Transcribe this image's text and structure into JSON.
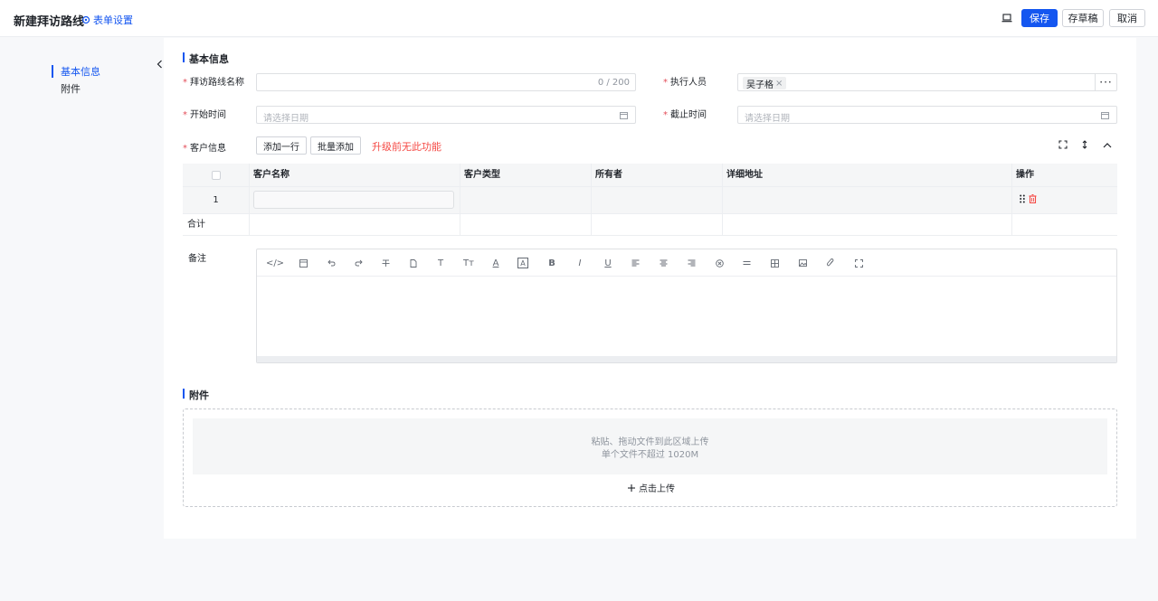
{
  "header": {
    "title": "新建拜访路线",
    "form_settings": "表单设置",
    "save": "保存",
    "draft": "存草稿",
    "cancel": "取消"
  },
  "nav": {
    "items": [
      "基本信息",
      "附件"
    ],
    "active": "基本信息"
  },
  "basic": {
    "section_title": "基本信息",
    "route_name_label": "拜访路线名称",
    "route_name_counter": "0 / 200",
    "executor_label": "执行人员",
    "executor_tag": "吴子格",
    "start_label": "开始时间",
    "start_placeholder": "请选择日期",
    "end_label": "截止时间",
    "end_placeholder": "请选择日期",
    "customer_label": "客户信息",
    "add_row": "添加一行",
    "batch_add": "批量添加",
    "upgrade_note": "升级前无此功能"
  },
  "table": {
    "headers": [
      "客户名称",
      "客户类型",
      "所有者",
      "详细地址",
      "操作"
    ],
    "row_index": "1",
    "total_label": "合计"
  },
  "remark": {
    "label": "备注",
    "toolbar": [
      "</>",
      "T",
      "Tт",
      "A",
      "B",
      "I",
      "U"
    ]
  },
  "attachment": {
    "section_title": "附件",
    "drop_text_1": "粘贴、拖动文件到此区域上传",
    "drop_text_2": "单个文件不超过 1020M",
    "upload_link": "点击上传"
  },
  "colors": {
    "primary": "#1456f0",
    "danger": "#f54a45",
    "required": "#e34d59"
  }
}
